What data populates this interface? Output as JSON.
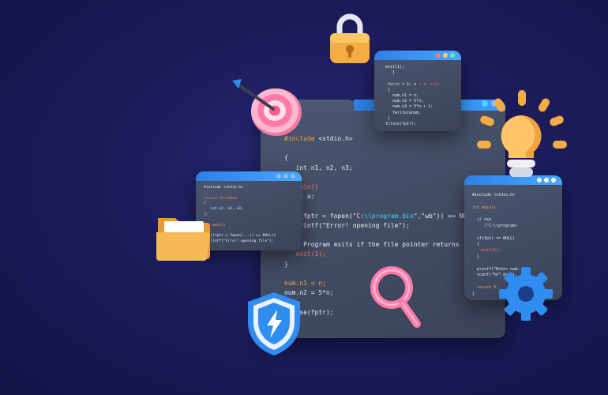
{
  "main_code": [
    {
      "segments": [
        {
          "t": "#include",
          "c": "or"
        },
        {
          "t": " <stdio.h>"
        }
      ]
    },
    {
      "segments": [
        {
          "t": ""
        }
      ]
    },
    {
      "segments": [
        {
          "t": "{"
        }
      ]
    },
    {
      "segments": [
        {
          "t": "   int n1, n2, n3;"
        }
      ]
    },
    {
      "segments": [
        {
          "t": "};"
        }
      ]
    },
    {
      "segments": [
        {
          "t": "nt main()",
          "c": "kw"
        }
      ]
    },
    {
      "segments": [
        {
          "t": "  int a;"
        }
      ]
    },
    {
      "segments": [
        {
          "t": ""
        }
      ]
    },
    {
      "segments": [
        {
          "t": "if ((fptr = fopen(\"C:"
        },
        {
          "t": "\\\\program.bin",
          "c": "hl"
        },
        {
          "t": "\",\"wb\")) == NUL"
        }
      ]
    },
    {
      "segments": [
        {
          "t": "   printf(\"Error! opening file\");"
        }
      ]
    },
    {
      "segments": [
        {
          "t": ""
        }
      ]
    },
    {
      "segments": [
        {
          "t": "  // Program exits if the file pointer returns"
        }
      ]
    },
    {
      "segments": [
        {
          "t": "   exit(1);",
          "c": "kw"
        }
      ]
    },
    {
      "segments": [
        {
          "t": "}"
        }
      ]
    },
    {
      "segments": [
        {
          "t": ""
        }
      ]
    },
    {
      "segments": [
        {
          "t": "num.n1 = n;",
          "c": "or"
        }
      ]
    },
    {
      "segments": [
        {
          "t": "num.n2 = 5*n;"
        }
      ]
    },
    {
      "segments": [
        {
          "t": "}"
        }
      ]
    },
    {
      "segments": [
        {
          "t": "fclose(fptr);"
        }
      ]
    }
  ],
  "top_code": [
    {
      "segments": [
        {
          "t": "exit(1);"
        }
      ]
    },
    {
      "segments": [
        {
          "t": "   }"
        }
      ]
    },
    {
      "segments": [
        {
          "t": ""
        }
      ]
    },
    {
      "segments": [
        {
          "t": " for(n = 1; n "
        },
        {
          "t": "< 5; ++n)",
          "c": "pk"
        }
      ]
    },
    {
      "segments": [
        {
          "t": " {"
        }
      ]
    },
    {
      "segments": [
        {
          "t": "   num.n1 = n;"
        }
      ]
    },
    {
      "segments": [
        {
          "t": "   num.n2 = 5*n;"
        }
      ]
    },
    {
      "segments": [
        {
          "t": "   num.n3 = 5*n + 1;"
        }
      ]
    },
    {
      "segments": [
        {
          "t": "   fwrite(&num,"
        }
      ]
    },
    {
      "segments": [
        {
          "t": " }"
        }
      ]
    },
    {
      "segments": [
        {
          "t": "fclose(fptr);"
        }
      ]
    }
  ],
  "left_code": [
    {
      "segments": [
        {
          "t": "#include <stdio.h>"
        }
      ]
    },
    {
      "segments": [
        {
          "t": ""
        }
      ]
    },
    {
      "segments": [
        {
          "t": "struct threeNum",
          "c": "kw"
        }
      ]
    },
    {
      "segments": [
        {
          "t": "{"
        }
      ]
    },
    {
      "segments": [
        {
          "t": "   int n1, n2, n3;"
        }
      ]
    },
    {
      "segments": [
        {
          "t": "};"
        }
      ]
    },
    {
      "segments": [
        {
          "t": ""
        }
      ]
    },
    {
      "segments": [
        {
          "t": "int main()",
          "c": "or"
        }
      ]
    },
    {
      "segments": [
        {
          "t": ""
        }
      ]
    },
    {
      "segments": [
        {
          "t": "if ((fptr = fopen(...)) == NULL){"
        }
      ]
    },
    {
      "segments": [
        {
          "t": "  printf(\"Error! opening file\");"
        }
      ]
    }
  ],
  "right_code": [
    {
      "segments": [
        {
          "t": "#include <stdio.h>"
        }
      ]
    },
    {
      "segments": [
        {
          "t": ""
        }
      ]
    },
    {
      "segments": [
        {
          "t": "int main()",
          "c": "or"
        }
      ]
    },
    {
      "segments": [
        {
          "t": ""
        }
      ]
    },
    {
      "segments": [
        {
          "t": "  // use"
        }
      ]
    },
    {
      "segments": [
        {
          "t": "     (\"C:\\\\program)"
        }
      ]
    },
    {
      "segments": [
        {
          "t": ""
        }
      ]
    },
    {
      "segments": [
        {
          "t": "  if(fptr == NULL)"
        }
      ]
    },
    {
      "segments": [
        {
          "t": "  {"
        }
      ]
    },
    {
      "segments": [
        {
          "t": "    exit(1);",
          "c": "kw"
        }
      ]
    },
    {
      "segments": [
        {
          "t": "  }"
        }
      ]
    },
    {
      "segments": [
        {
          "t": ""
        }
      ]
    },
    {
      "segments": [
        {
          "t": "  printf(\"Enter num: \");"
        }
      ]
    },
    {
      "segments": [
        {
          "t": "  scanf(\"%d\",&num);"
        }
      ]
    },
    {
      "segments": [
        {
          "t": ""
        }
      ]
    },
    {
      "segments": [
        {
          "t": "  return 0;",
          "c": "or"
        }
      ]
    },
    {
      "segments": [
        {
          "t": "}"
        }
      ]
    }
  ],
  "icons": [
    "lock-icon",
    "target-dart-icon",
    "lightbulb-icon",
    "folder-icon",
    "shield-lightning-icon",
    "magnifier-icon",
    "gear-icon"
  ],
  "colors": {
    "background": "#1c1c5c",
    "panel": "#414b63",
    "bar": "#3a8ff0",
    "accent_orange": "#f6b24e",
    "accent_pink": "#ff7aa8",
    "accent_blue": "#2f8cf0"
  }
}
